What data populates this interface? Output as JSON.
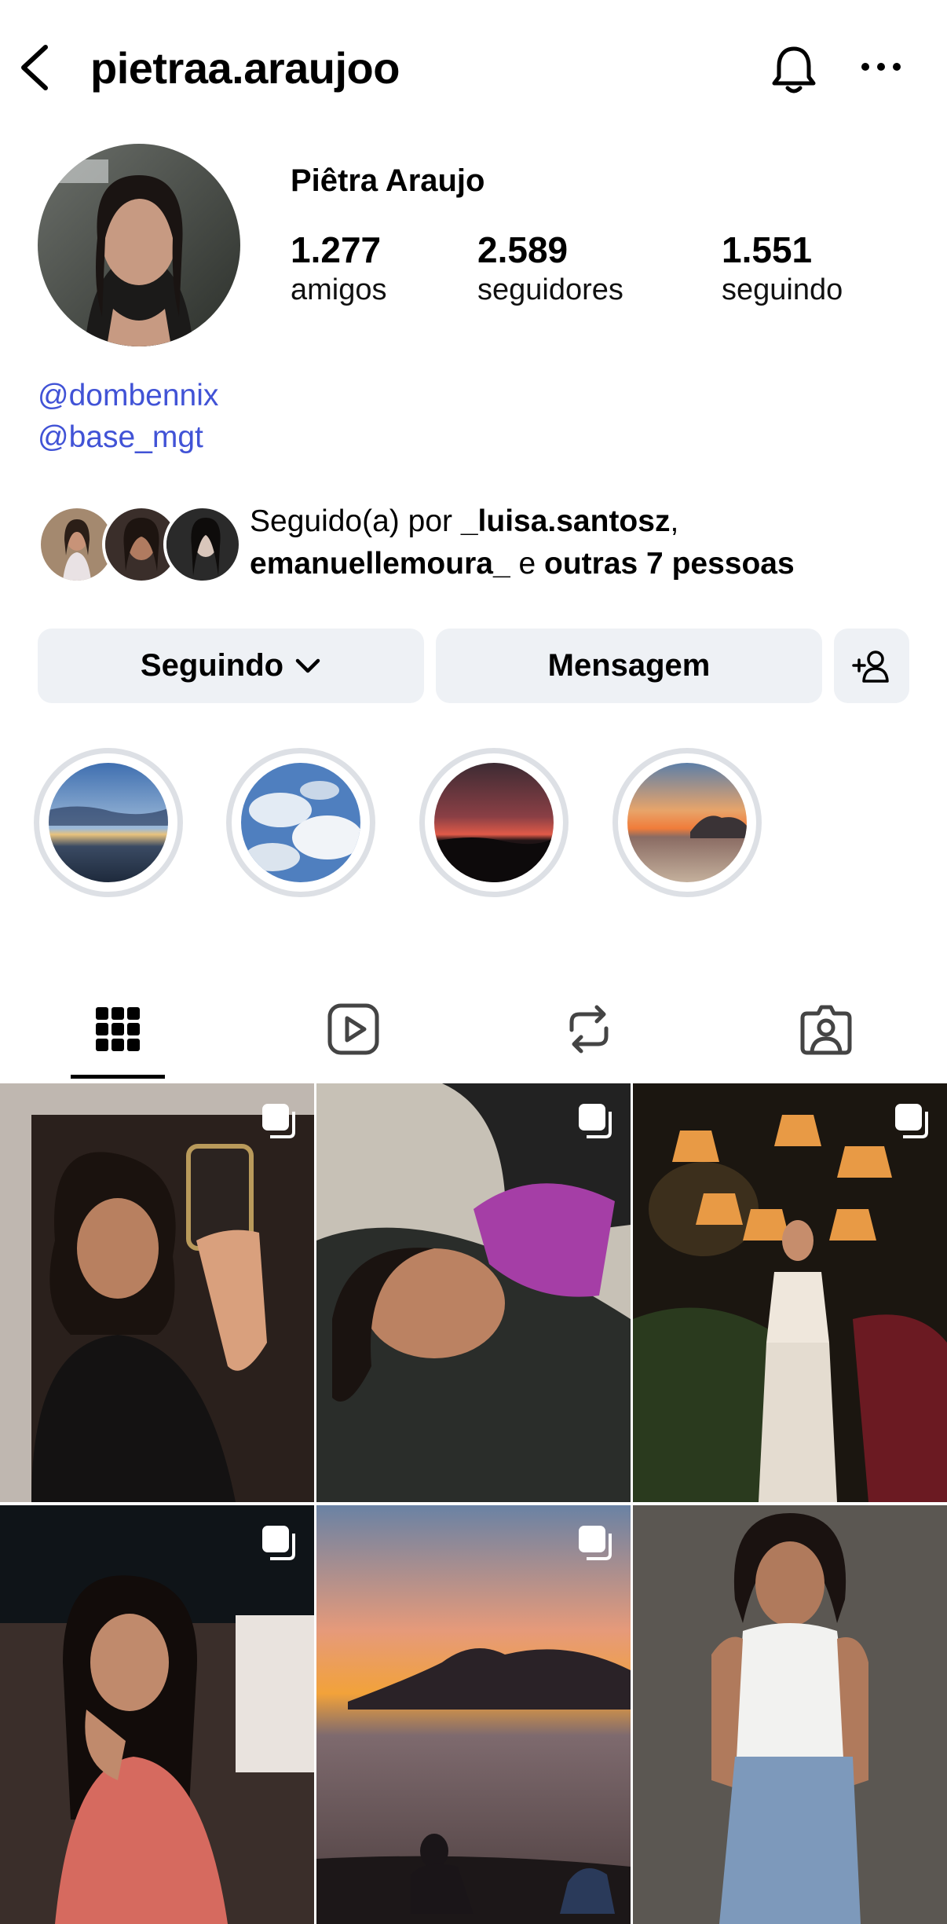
{
  "header": {
    "username": "pietraa.araujoo",
    "icons": {
      "back": "chevron-left-icon",
      "notify": "bell-icon",
      "more": "more-horizontal-icon"
    }
  },
  "profile": {
    "display_name": "Piêtra Araujo",
    "stats": [
      {
        "value": "1.277",
        "label": "amigos"
      },
      {
        "value": "2.589",
        "label": "seguidores"
      },
      {
        "value": "1.551",
        "label": "seguindo"
      }
    ],
    "links": [
      "@dombennix",
      "@base_mgt"
    ]
  },
  "followed_by": {
    "prefix": "Seguido(a) por ",
    "user1": "_luisa.santosz",
    "comma": ",",
    "user2": "emanuellemoura_",
    "and": " e ",
    "others": "outras 7 pessoas"
  },
  "actions": {
    "following_label": "Seguindo",
    "message_label": "Mensagem"
  },
  "tabs": [
    "grid-icon",
    "reels-icon",
    "reposts-icon",
    "tagged-icon"
  ],
  "colors": {
    "link": "#4153d6",
    "button_bg": "#eef1f5",
    "highlight_ring": "#dde0e5"
  }
}
